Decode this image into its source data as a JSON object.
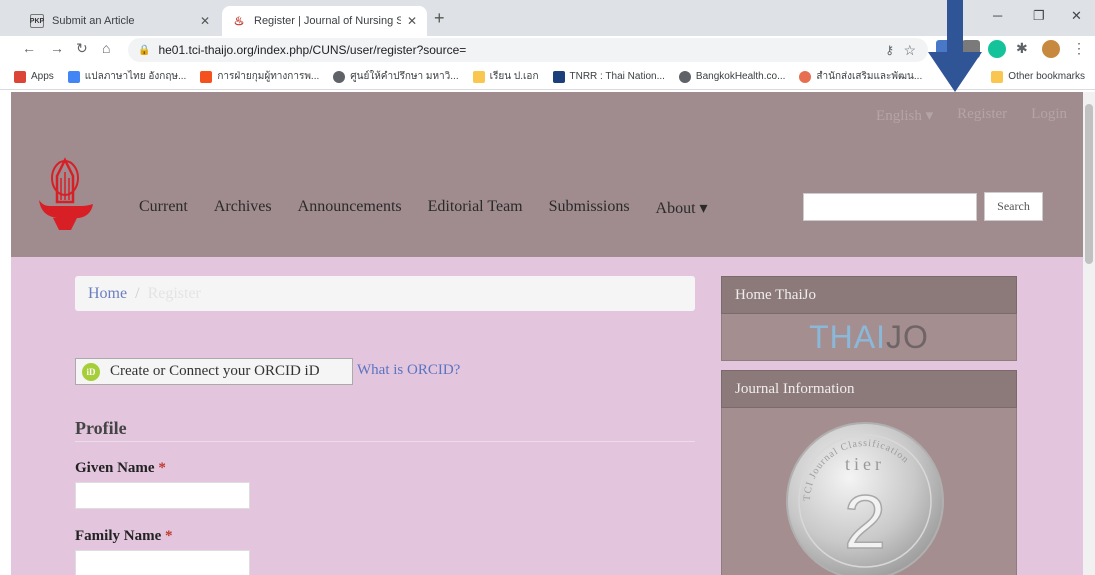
{
  "browser": {
    "tabs": [
      {
        "favicon_text": "PKP",
        "title": "Submit an Article",
        "active": false
      },
      {
        "favicon_text": "♨",
        "title": "Register | Journal of Nursing Scie",
        "active": true
      }
    ],
    "new_tab": "+",
    "window_controls": {
      "minimize": "─",
      "restore": "❐",
      "close": "✕"
    },
    "url": "he01.tci-thaijo.org/index.php/CUNS/user/register?source=",
    "bookmarks": [
      {
        "label": "Apps",
        "color": "#db4437"
      },
      {
        "label": "แปลภาษาไทย อังกฤษ...",
        "color": "#4285f4"
      },
      {
        "label": "การฝ่ายกุมผู้ทางการพ...",
        "color": "#f4511e"
      },
      {
        "label": "ศูนย์ให้คำปรึกษา มหาวิ...",
        "color": "#5f6368"
      },
      {
        "label": "เรียน ป.เอก",
        "color": "#f9c74f"
      },
      {
        "label": "TNRR : Thai Nation...",
        "color": "#1a3f7a"
      },
      {
        "label": "BangkokHealth.co...",
        "color": "#5f6368"
      },
      {
        "label": "สำนักส่งเสริมและพัฒน...",
        "color": "#e76f51"
      }
    ],
    "other_bookmarks": "Other bookmarks"
  },
  "header": {
    "top_links": {
      "language": "English ▾",
      "register": "Register",
      "login": "Login"
    },
    "nav": [
      "Current",
      "Archives",
      "Announcements",
      "Editorial Team",
      "Submissions",
      "About ▾"
    ],
    "search": {
      "placeholder": "",
      "button": "Search"
    }
  },
  "breadcrumb": {
    "home": "Home",
    "separator": "/",
    "current": "Register"
  },
  "orcid": {
    "icon_text": "iD",
    "button": "Create or Connect your ORCID iD",
    "link": "What is ORCID?"
  },
  "profile": {
    "title": "Profile",
    "fields": [
      {
        "label": "Given Name",
        "required": "*",
        "value": ""
      },
      {
        "label": "Family Name",
        "required": "*",
        "value": ""
      }
    ]
  },
  "sidebar": {
    "home_thaijo": {
      "title": "Home ThaiJo",
      "logo_part1": "THAI",
      "logo_part2": "JO"
    },
    "journal_info": {
      "title": "Journal Information",
      "badge_tier": "tier",
      "badge_number": "2",
      "badge_ring": "TCI Journal Classification"
    }
  },
  "colors": {
    "header_bg": "#a08c8e",
    "page_bg": "#e3c6de",
    "sidebar_head": "#8c7a7b",
    "link": "#5b74c0",
    "annotation_arrow": "#2f5596"
  }
}
